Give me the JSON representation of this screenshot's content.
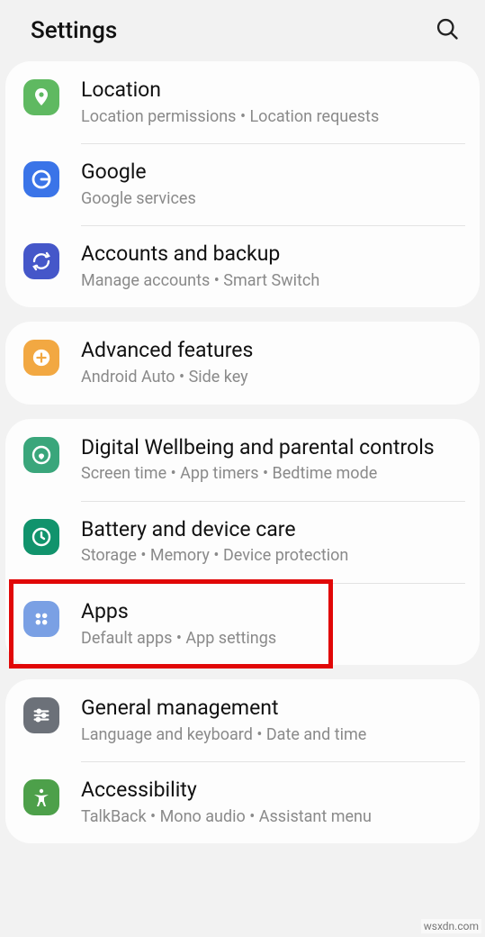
{
  "header": {
    "title": "Settings"
  },
  "groups": [
    {
      "items": [
        {
          "id": "location",
          "title": "Location",
          "sub": "Location permissions  •  Location requests",
          "bg": "#5fb961",
          "icon": "location"
        },
        {
          "id": "google",
          "title": "Google",
          "sub": "Google services",
          "bg": "#3a74e8",
          "icon": "google"
        },
        {
          "id": "accounts",
          "title": "Accounts and backup",
          "sub": "Manage accounts  •  Smart Switch",
          "bg": "#4557c9",
          "icon": "sync"
        }
      ]
    },
    {
      "items": [
        {
          "id": "advanced",
          "title": "Advanced features",
          "sub": "Android Auto  •  Side key",
          "bg": "#f2a842",
          "icon": "gear-plus"
        }
      ]
    },
    {
      "items": [
        {
          "id": "digital-wellbeing",
          "title": "Digital Wellbeing and parental controls",
          "sub": "Screen time  •  App timers  •  Bedtime mode",
          "bg": "#3aa67b",
          "icon": "wellbeing"
        },
        {
          "id": "battery",
          "title": "Battery and device care",
          "sub": "Storage  •  Memory  •  Device protection",
          "bg": "#11936c",
          "icon": "care"
        },
        {
          "id": "apps",
          "title": "Apps",
          "sub": "Default apps  •  App settings",
          "bg": "#7aa0e4",
          "icon": "apps",
          "highlight": true
        }
      ]
    },
    {
      "items": [
        {
          "id": "general",
          "title": "General management",
          "sub": "Language and keyboard  •  Date and time",
          "bg": "#6c7179",
          "icon": "sliders"
        },
        {
          "id": "accessibility",
          "title": "Accessibility",
          "sub": "TalkBack  •  Mono audio  •  Assistant menu",
          "bg": "#4da04a",
          "icon": "accessibility"
        }
      ]
    }
  ],
  "watermark": "wsxdn.com"
}
